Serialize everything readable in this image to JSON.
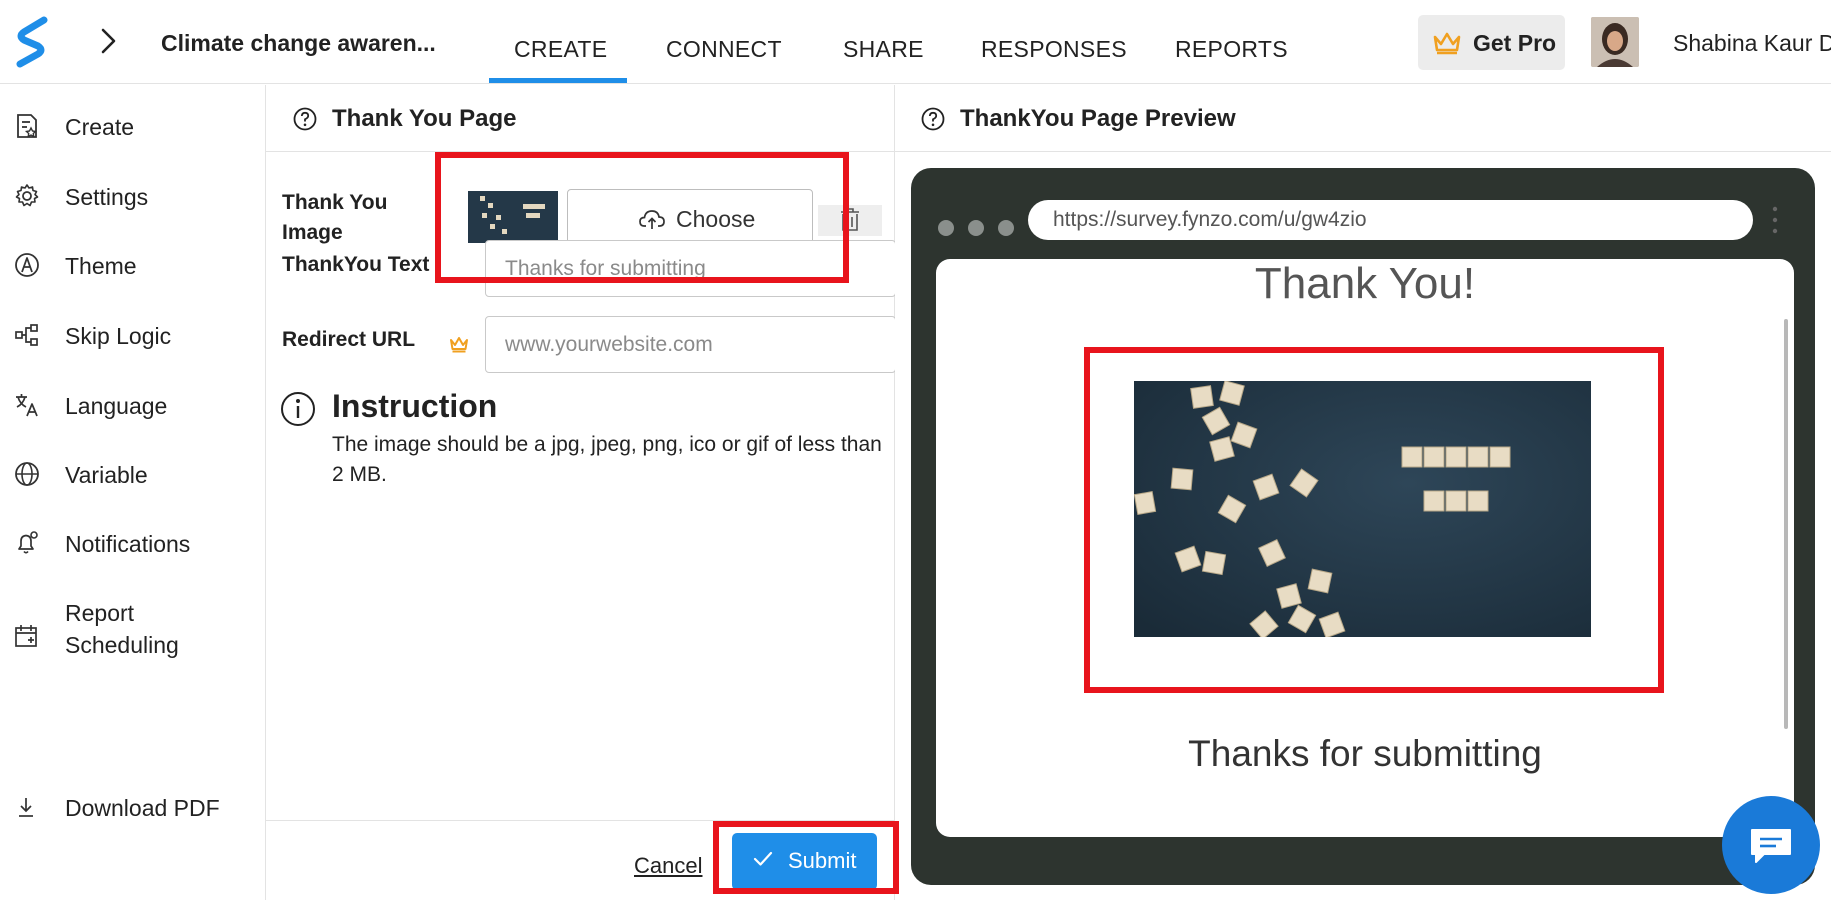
{
  "header": {
    "form_title": "Climate change awaren...",
    "tabs": [
      {
        "label": "CREATE",
        "active": true
      },
      {
        "label": "CONNECT"
      },
      {
        "label": "SHARE"
      },
      {
        "label": "RESPONSES"
      },
      {
        "label": "REPORTS"
      }
    ],
    "get_pro": "Get Pro",
    "user_name": "Shabina Kaur D"
  },
  "sidebar": {
    "items": [
      {
        "label": "Create",
        "icon": "create-form-icon"
      },
      {
        "label": "Settings",
        "icon": "gear-icon"
      },
      {
        "label": "Theme",
        "icon": "theme-icon"
      },
      {
        "label": "Skip Logic",
        "icon": "skip-logic-icon"
      },
      {
        "label": "Language",
        "icon": "translate-icon"
      },
      {
        "label": "Variable",
        "icon": "globe-icon"
      },
      {
        "label": "Notifications",
        "icon": "bell-icon"
      },
      {
        "label": "Report",
        "label2": "Scheduling",
        "icon": "calendar-icon"
      },
      {
        "label": "Download PDF",
        "icon": "download-icon"
      }
    ]
  },
  "thank_you_panel": {
    "title": "Thank You Page",
    "image_label_line1": "Thank You",
    "image_label_line2": "Image",
    "choose_label": "Choose",
    "text_label": "ThankYou Text",
    "text_placeholder": "Thanks for submitting",
    "redirect_label": "Redirect URL",
    "redirect_placeholder": "www.yourwebsite.com",
    "instruction_title": "Instruction",
    "instruction_text": "The image should be a jpg, jpeg, png, ico or gif of less than 2 MB.",
    "cancel_label": "Cancel",
    "submit_label": "Submit"
  },
  "preview": {
    "title": "ThankYou Page Preview",
    "url": "https://survey.fynzo.com/u/gw4zio",
    "heading": "Thank You!",
    "message": "Thanks for submitting"
  },
  "colors": {
    "accent": "#1f8ee8",
    "highlight": "#e8141c",
    "browser_frame": "#2d342f"
  }
}
